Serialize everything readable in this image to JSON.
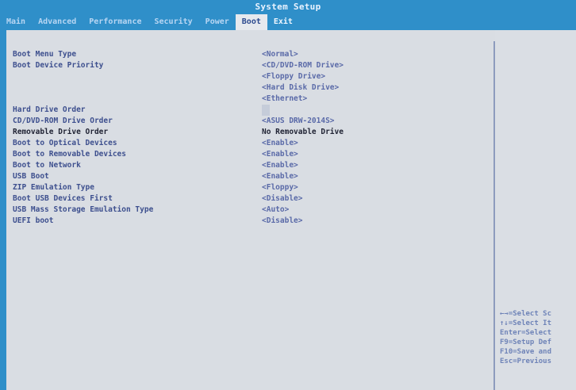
{
  "title": "System Setup",
  "tabs": [
    {
      "label": "Main"
    },
    {
      "label": "Advanced"
    },
    {
      "label": "Performance"
    },
    {
      "label": "Security"
    },
    {
      "label": "Power"
    },
    {
      "label": "Boot"
    },
    {
      "label": "Exit"
    }
  ],
  "settings": [
    {
      "label": "Boot Menu Type",
      "value": "<Normal>"
    },
    {
      "label": "Boot Device Priority",
      "value": "<CD/DVD-ROM Drive>"
    },
    {
      "label": "",
      "value": "<Floppy Drive>"
    },
    {
      "label": "",
      "value": "<Hard Disk Drive>"
    },
    {
      "label": "",
      "value": "<Ethernet>"
    },
    {
      "label": "Hard Drive Order",
      "value": ""
    },
    {
      "label": "CD/DVD-ROM Drive Order",
      "value": "<ASUS   DRW-2014S>"
    },
    {
      "label": "Removable Drive Order",
      "value": "No Removable Drive"
    },
    {
      "label": "Boot to Optical Devices",
      "value": "<Enable>"
    },
    {
      "label": "Boot to Removable Devices",
      "value": "<Enable>"
    },
    {
      "label": "Boot to Network",
      "value": "<Enable>"
    },
    {
      "label": "USB Boot",
      "value": "<Enable>"
    },
    {
      "label": "ZIP Emulation Type",
      "value": "<Floppy>"
    },
    {
      "label": "Boot USB Devices First",
      "value": "<Disable>"
    },
    {
      "label": "USB Mass Storage Emulation Type",
      "value": "<Auto>"
    },
    {
      "label": "UEFI boot",
      "value": "<Disable>"
    }
  ],
  "help": [
    "←→=Select Sc",
    "↑↓=Select It",
    "Enter=Select",
    "F9=Setup Def",
    "F10=Save and",
    "Esc=Previous"
  ]
}
